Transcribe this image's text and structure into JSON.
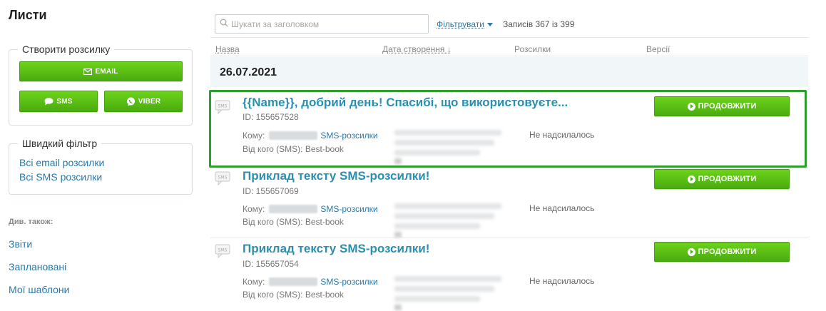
{
  "sidebar": {
    "title": "Листи",
    "create": {
      "legend": "Створити розсилку",
      "email_label": "EMAIL",
      "sms_label": "SMS",
      "viber_label": "VIBER"
    },
    "quick_filter": {
      "legend": "Швидкий фільтр",
      "links": [
        "Всі email розсилки",
        "Всі SMS розсилки"
      ]
    },
    "see_also": {
      "label": "Див. також:",
      "links": [
        "Звіти",
        "Заплановані",
        "Мої шаблони"
      ]
    }
  },
  "toolbar": {
    "search_placeholder": "Шукати за заголовком",
    "filter_label": "Фільтрувати",
    "records_text": "Записів 367 із 399"
  },
  "table": {
    "columns": [
      "Назва",
      "Дата створення ↓",
      "Розсилки",
      "Версії"
    ],
    "date_group": "26.07.2021",
    "rows": [
      {
        "title": "{{Name}}, добрий день! Спасибі, що використовуєте...",
        "id": "ID: 155657528",
        "to_prefix": "Кому:",
        "to_link": "SMS-розсилки",
        "from": "Від кого (SMS): Best-book",
        "status": "Не надсилалось",
        "button": "ПРОДОВЖИТИ"
      },
      {
        "title": "Приклад тексту SMS-розсилки!",
        "id": "ID: 155657069",
        "to_prefix": "Кому:",
        "to_link": "SMS-розсилки",
        "from": "Від кого (SMS): Best-book",
        "status": "Не надсилалось",
        "button": "ПРОДОВЖИТИ"
      },
      {
        "title": "Приклад тексту SMS-розсилки!",
        "id": "ID: 155657054",
        "to_prefix": "Кому:",
        "to_link": "SMS-розсилки",
        "from": "Від кого (SMS): Best-book",
        "status": "Не надсилалось",
        "button": "ПРОДОВЖИТИ"
      }
    ]
  },
  "colors": {
    "accent_green": "#4aab0f",
    "link_blue": "#2a79a8",
    "title_blue": "#2a8fb0",
    "highlight_border": "#2e9e2e",
    "date_band": "#f1f6f8"
  },
  "icons": [
    "email-icon",
    "sms-bubble-icon",
    "viber-icon",
    "search-icon",
    "sms-message-icon",
    "play-circle-icon"
  ]
}
